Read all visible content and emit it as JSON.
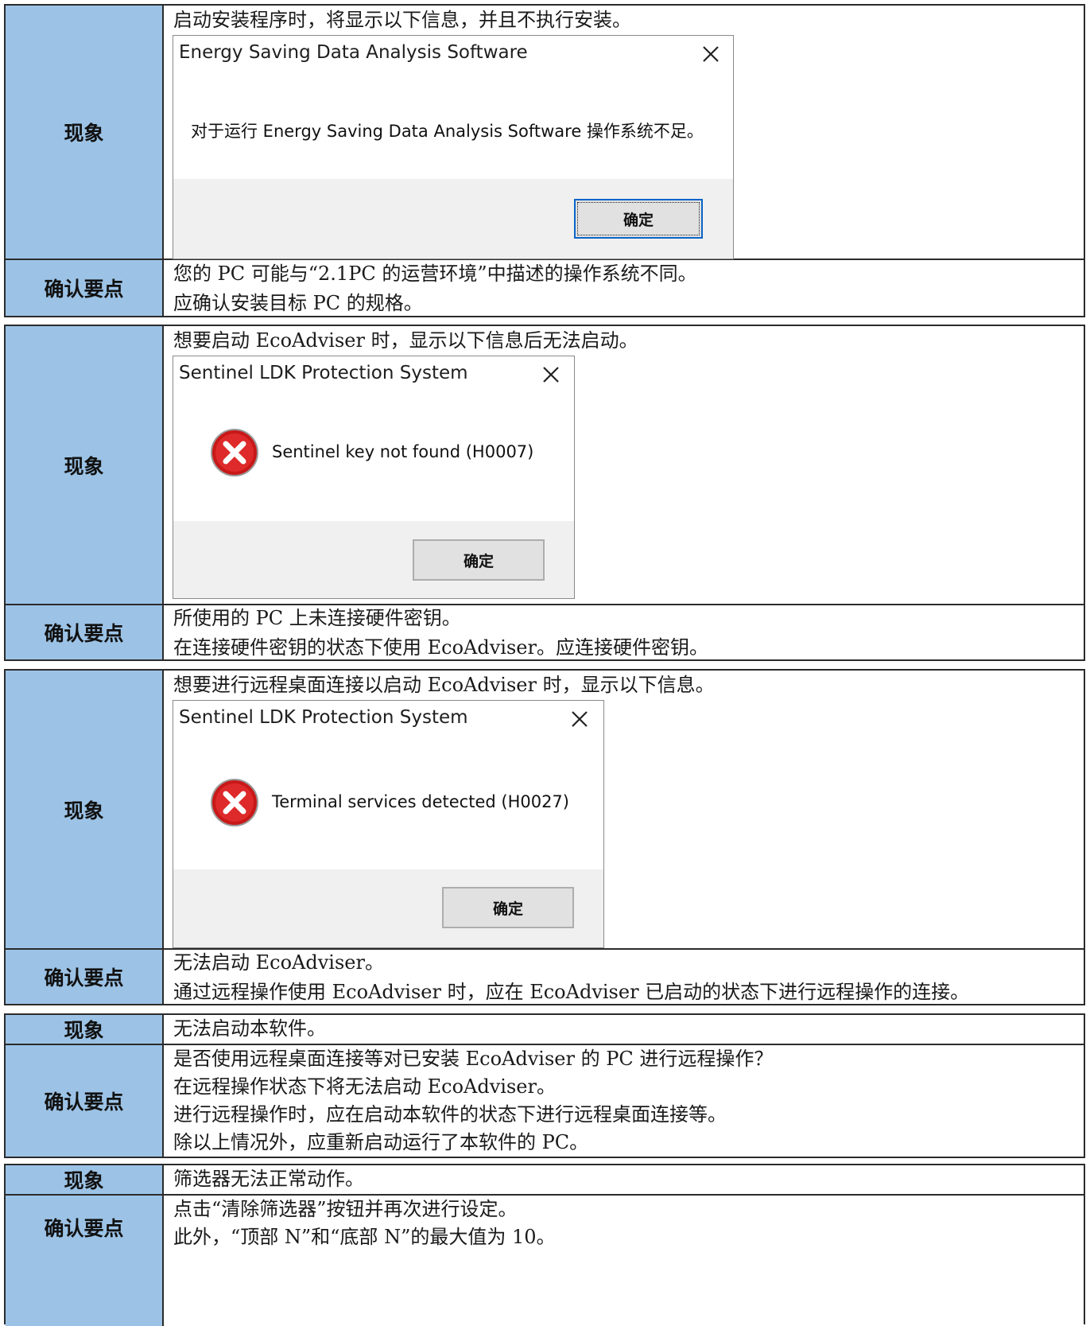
{
  "labels": {
    "phenomenon": "现象",
    "check": "确认要点"
  },
  "section1": {
    "phenomenon": "启动安装程序时，将显示以下信息，并且不执行安装。",
    "dialog": {
      "title": "Energy Saving Data Analysis Software",
      "message": "对于运行 Energy Saving Data Analysis Software 操作系统不足。",
      "button": "确定",
      "close_icon": "close-icon"
    },
    "check": [
      "您的 PC 可能与“2.1PC 的运营环境”中描述的操作系统不同。",
      "应确认安装目标 PC 的规格。"
    ]
  },
  "section2": {
    "phenomenon": "想要启动 EcoAdviser 时，显示以下信息后无法启动。",
    "dialog": {
      "title": "Sentinel LDK Protection System",
      "message": "Sentinel key not found (H0007)",
      "button": "确定",
      "icon": "error-icon"
    },
    "check": [
      "所使用的 PC 上未连接硬件密钥。",
      "在连接硬件密钥的状态下使用 EcoAdviser。应连接硬件密钥。"
    ]
  },
  "section3": {
    "phenomenon": "想要进行远程桌面连接以启动 EcoAdviser 时，显示以下信息。",
    "dialog": {
      "title": "Sentinel LDK Protection System",
      "message": "Terminal services detected (H0027)",
      "button": "确定",
      "icon": "error-icon"
    },
    "check": [
      "无法启动 EcoAdviser。",
      "通过远程操作使用 EcoAdviser 时，应在 EcoAdviser 已启动的状态下进行远程操作的连接。"
    ]
  },
  "section4": {
    "phenomenon": "无法启动本软件。",
    "check": [
      "是否使用远程桌面连接等对已安装 EcoAdviser 的 PC 进行远程操作？",
      "在远程操作状态下将无法启动 EcoAdviser。",
      "进行远程操作时，应在启动本软件的状态下进行远程桌面连接等。",
      "除以上情况外，应重新启动运行了本软件的 PC。"
    ]
  },
  "section5": {
    "phenomenon": "筛选器无法正常动作。",
    "check": [
      "点击“清除筛选器”按钮并再次进行设定。",
      "此外，“顶部 N”和“底部 N”的最大值为 10。"
    ]
  },
  "colors": {
    "label_bg": "#9cc3e6",
    "border": "#2b2b2b",
    "dialog_footer": "#f0f0f0",
    "focus_border": "#0a64c8",
    "error_red": "#d42020"
  }
}
